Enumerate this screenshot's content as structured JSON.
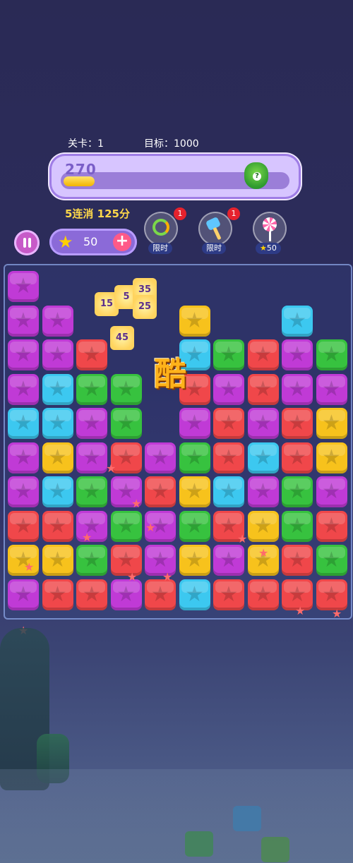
{
  "hud": {
    "level_label": "关卡：",
    "level_value": "1",
    "target_label": "目标：",
    "target_value": "1000",
    "score": "270",
    "progress_fraction": 0.14,
    "combo_text": "5连消 125分"
  },
  "wallet": {
    "coins": "50",
    "plus": "+"
  },
  "tools": [
    {
      "icon": "refresh-icon",
      "label": "限时",
      "badge": "1"
    },
    {
      "icon": "hammer-icon",
      "label": "限时",
      "badge": "1"
    },
    {
      "icon": "lollipop-icon",
      "label": "50",
      "badge": ""
    }
  ],
  "board": {
    "grid": [
      [
        "P",
        "",
        "",
        "",
        "",
        "",
        "",
        "",
        "",
        ""
      ],
      [
        "P",
        "P",
        "",
        "",
        "",
        "Y",
        "",
        "",
        "B",
        ""
      ],
      [
        "P",
        "P",
        "R",
        "",
        "",
        "B",
        "G",
        "R",
        "P",
        "G"
      ],
      [
        "P",
        "B",
        "G",
        "G",
        "",
        "R",
        "P",
        "R",
        "P",
        "P"
      ],
      [
        "B",
        "B",
        "P",
        "G",
        "",
        "P",
        "R",
        "P",
        "R",
        "Y"
      ],
      [
        "P",
        "Y",
        "P",
        "R",
        "P",
        "G",
        "R",
        "B",
        "R",
        "Y"
      ],
      [
        "P",
        "B",
        "G",
        "P",
        "R",
        "Y",
        "B",
        "P",
        "G",
        "P"
      ],
      [
        "R",
        "R",
        "P",
        "G",
        "P",
        "G",
        "R",
        "Y",
        "G",
        "R"
      ],
      [
        "Y",
        "Y",
        "G",
        "R",
        "P",
        "Y",
        "P",
        "Y",
        "R",
        "G"
      ],
      [
        "P",
        "R",
        "R",
        "P",
        "R",
        "B",
        "R",
        "R",
        "R",
        "R"
      ]
    ],
    "colors": {
      "P": "#c03ad6",
      "R": "#f0474a",
      "G": "#37c23f",
      "B": "#3cc8f0",
      "Y": "#f7c21c"
    },
    "popups": [
      "15",
      "5",
      "35",
      "25",
      "45"
    ],
    "cool_text": "酷"
  }
}
